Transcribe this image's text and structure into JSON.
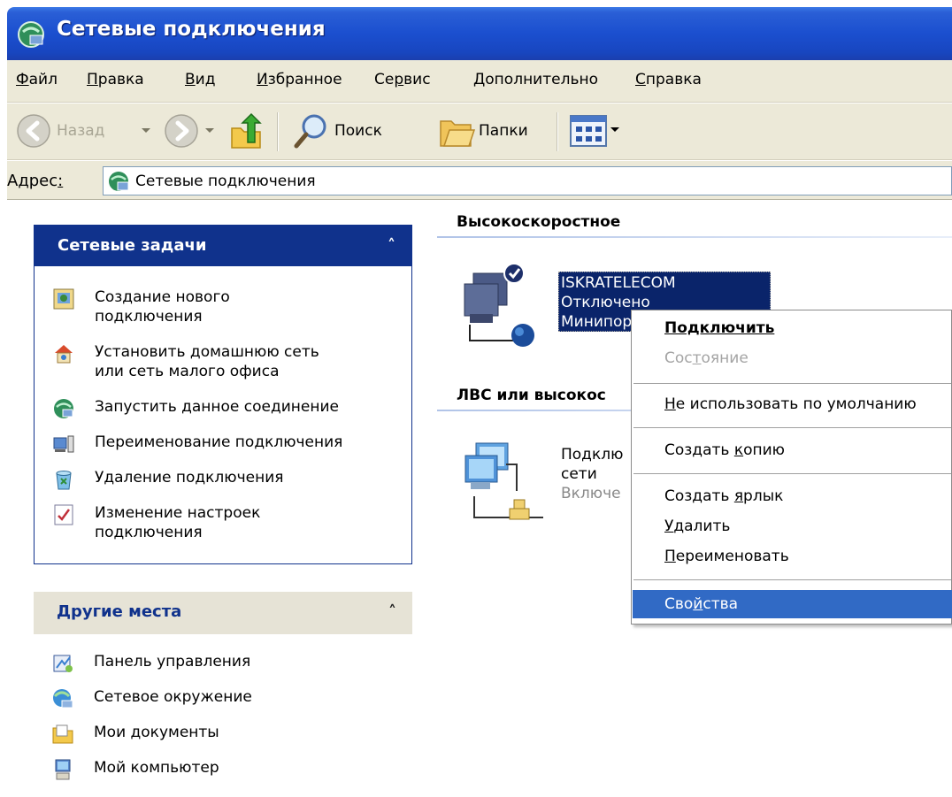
{
  "window": {
    "title": "Сетевые подключения"
  },
  "menubar": {
    "items": [
      {
        "label": "Файл",
        "accel": "Ф",
        "rest": "айл"
      },
      {
        "label": "Правка",
        "accel": "П",
        "rest": "равка"
      },
      {
        "label": "Вид",
        "accel": "В",
        "rest": "ид"
      },
      {
        "label": "Избранное",
        "accel": "И",
        "rest": "збранное"
      },
      {
        "label": "Сервис",
        "pre": "Се",
        "accel": "р",
        "rest": "вис"
      },
      {
        "label": "Дополнительно",
        "accel": "Д",
        "rest": "ополнительно"
      },
      {
        "label": "Справка",
        "accel": "С",
        "rest": "правка"
      }
    ]
  },
  "toolbar": {
    "back_label": "Назад",
    "search_label": "Поиск",
    "folders_label": "Папки"
  },
  "address": {
    "label_pre": "Адрес",
    "label_accel": ":",
    "value": "Сетевые подключения"
  },
  "network_tasks": {
    "title": "Сетевые задачи",
    "items": [
      {
        "label": "Создание нового\nподключения",
        "icon": "new-connection-icon"
      },
      {
        "label": "Установить домашнюю сеть\nили сеть малого офиса",
        "icon": "home-network-icon"
      },
      {
        "label": "Запустить данное соединение",
        "icon": "start-connection-icon"
      },
      {
        "label": "Переименование подключения",
        "icon": "rename-icon"
      },
      {
        "label": "Удаление подключения",
        "icon": "delete-icon"
      },
      {
        "label": "Изменение настроек\nподключения",
        "icon": "change-settings-icon"
      }
    ]
  },
  "other_places": {
    "title": "Другие места",
    "items": [
      {
        "label": "Панель управления",
        "icon": "control-panel-icon"
      },
      {
        "label": "Сетевое окружение",
        "icon": "network-places-icon"
      },
      {
        "label": "Мои документы",
        "icon": "my-documents-icon"
      },
      {
        "label": "Мой компьютер",
        "icon": "my-computer-icon"
      }
    ]
  },
  "groups": {
    "highspeed": {
      "title": "Высокоскоростное",
      "connection": {
        "name": "ISKRATELECOM",
        "status": "Отключено",
        "device": "Минипор"
      }
    },
    "lan": {
      "title": "ЛВС или высокос",
      "connection": {
        "name": "Подклю",
        "name2": "сети",
        "status": "Включе"
      }
    }
  },
  "context_menu": {
    "connect": "Подключить",
    "status": {
      "pre": "Сос",
      "accel": "т",
      "rest": "ояние"
    },
    "not_default": {
      "pre": "",
      "accel": "Н",
      "rest": "е использовать по умолчанию"
    },
    "create_copy": {
      "pre": "Создать ",
      "accel": "к",
      "rest": "опию"
    },
    "create_shortcut": {
      "pre": "Создать ",
      "accel": "я",
      "rest": "рлык"
    },
    "delete": {
      "pre": "",
      "accel": "У",
      "rest": "далить"
    },
    "rename": {
      "pre": "",
      "accel": "П",
      "rest": "ереименовать"
    },
    "properties": {
      "pre": "Сво",
      "accel": "й",
      "rest": "ства"
    }
  },
  "colors": {
    "titlebar": "#1b4fcf",
    "panel_head_blue": "#10328c",
    "panel_head_grey": "#e6e3d6",
    "highlight": "#316ac5",
    "selection": "#0a246a"
  }
}
